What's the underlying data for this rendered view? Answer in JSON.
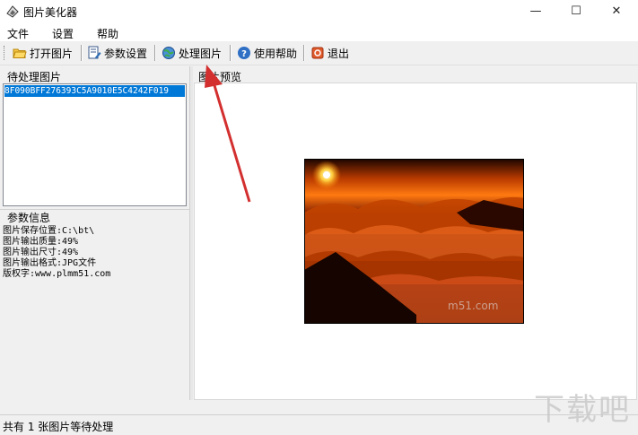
{
  "window": {
    "title": "图片美化器",
    "minimize": "—",
    "maximize": "☐",
    "close": "✕"
  },
  "menu": [
    "文件",
    "设置",
    "帮助"
  ],
  "toolbar": {
    "open": "打开图片",
    "settings": "参数设置",
    "process": "处理图片",
    "help": "使用帮助",
    "exit": "退出"
  },
  "left": {
    "pending_label": "待处理图片",
    "files": [
      "8F090BFF276393C5A9010E5C4242F019"
    ],
    "info_label": "参数信息",
    "info_lines": [
      "图片保存位置:C:\\bt\\",
      "图片输出质量:49%",
      "图片输出尺寸:49%",
      "图片输出格式:JPG文件",
      "版权字:www.plmm51.com"
    ]
  },
  "preview": {
    "label": "图片预览",
    "photo_caption": "m51.com"
  },
  "status": {
    "text": "共有 1 张图片等待处理"
  },
  "watermark": "下载吧",
  "colors": {
    "selection": "#0078d7",
    "arrow": "#d32f2f",
    "accent": "#0078d7"
  }
}
